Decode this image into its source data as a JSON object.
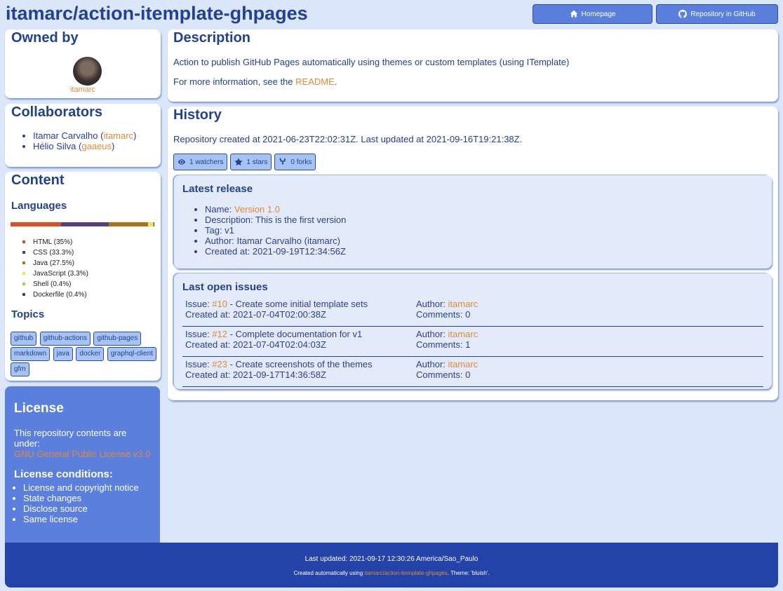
{
  "header": {
    "title": "itamarc/action-itemplate-ghpages",
    "homepage_label": "Homepage",
    "repo_label": "Repository in GitHub"
  },
  "owned_by": {
    "title": "Owned by",
    "login": "itamarc"
  },
  "collaborators": {
    "title": "Collaborators",
    "items": [
      {
        "name": "Itamar Carvalho",
        "login": "itamarc"
      },
      {
        "name": "Hélio Silva",
        "login": "gaaeus"
      }
    ]
  },
  "content": {
    "title": "Content",
    "languages_title": "Languages",
    "languages": [
      {
        "name": "HTML",
        "percent": 35,
        "label": "HTML (35%)",
        "color": "#e34c26"
      },
      {
        "name": "CSS",
        "percent": 33.3,
        "label": "CSS (33.3%)",
        "color": "#563d7c"
      },
      {
        "name": "Java",
        "percent": 27.5,
        "label": "Java (27.5%)",
        "color": "#b07219"
      },
      {
        "name": "JavaScript",
        "percent": 3.3,
        "label": "JavaScript (3.3%)",
        "color": "#f1e05a"
      },
      {
        "name": "Shell",
        "percent": 0.4,
        "label": "Shell (0.4%)",
        "color": "#89e051"
      },
      {
        "name": "Dockerfile",
        "percent": 0.4,
        "label": "Dockerfile (0.4%)",
        "color": "#384d54"
      }
    ],
    "topics_title": "Topics",
    "topics": [
      "github",
      "github-actions",
      "github-pages",
      "markdown",
      "java",
      "docker",
      "graphql-client",
      "gfm"
    ]
  },
  "license": {
    "title": "License",
    "text": "This repository contents are under:",
    "name": "GNU General Public License v3.0",
    "conditions_title": "License conditions:",
    "conditions": [
      "License and copyright notice",
      "State changes",
      "Disclose source",
      "Same license"
    ]
  },
  "description": {
    "title": "Description",
    "text": "Action to publish GitHub Pages automatically using themes or custom templates (using ITemplate)",
    "more_prefix": "For more information, see the ",
    "more_link": "README",
    "more_suffix": "."
  },
  "history": {
    "title": "History",
    "text": "Repository created at 2021-06-23T22:02:31Z. Last updated at 2021-09-16T19:21:38Z.",
    "watchers": "1 watchers",
    "stars": "1 stars",
    "forks": "0 forks"
  },
  "release": {
    "title": "Latest release",
    "name_label": "Name: ",
    "name_value": "Version 1.0",
    "description": "Description: This is the first version",
    "tag": "Tag: v1",
    "author": "Author: Itamar Carvalho (itamarc)",
    "created": "Created at: 2021-09-19T12:34:56Z"
  },
  "issues": {
    "title": "Last open issues",
    "issue_label": "Issue: ",
    "author_label": "Author: ",
    "items": [
      {
        "number": "#10",
        "title": " - Create some initial template sets",
        "created": "Created at: 2021-07-04T02:00:38Z",
        "author": "itamarc",
        "comments": "Comments: 0"
      },
      {
        "number": "#12",
        "title": " - Complete documentation for v1",
        "created": "Created at: 2021-07-04T02:04:03Z",
        "author": "itamarc",
        "comments": "Comments: 1"
      },
      {
        "number": "#23",
        "title": " - Create screenshots of the themes",
        "created": "Created at: 2021-09-17T14:36:58Z",
        "author": "itamarc",
        "comments": "Comments: 0"
      }
    ]
  },
  "footer": {
    "updated": "Last updated: 2021-09-17 12:30:26 America/Sao_Paulo",
    "credit_prefix": "Created automatically using ",
    "credit_link": "itamarc/action-itemplate-ghpages",
    "credit_suffix": ". Theme: 'bluish'."
  },
  "colors": {
    "background": "#dbe6fb",
    "primary": "#22418f",
    "accent": "#5b7fdd",
    "link": "#e08a3a",
    "footer": "#2443a8"
  }
}
